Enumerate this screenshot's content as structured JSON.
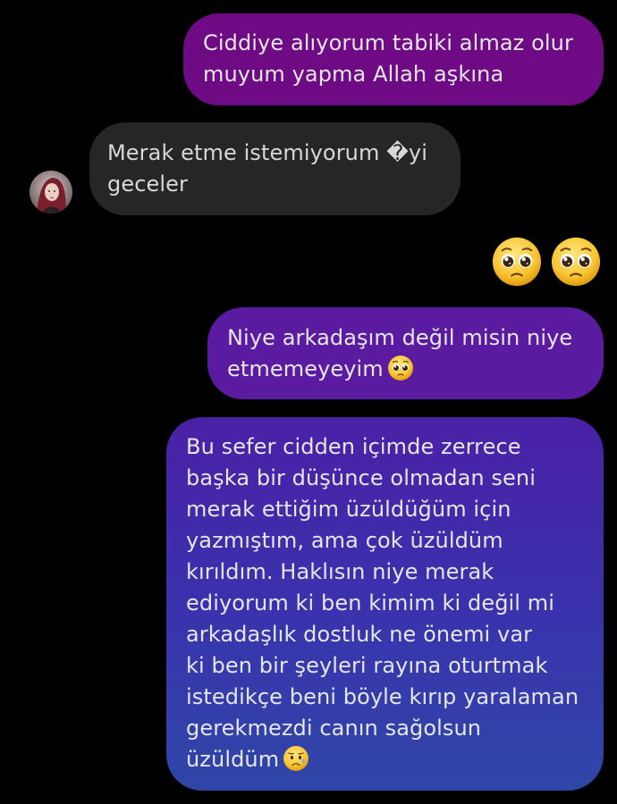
{
  "messages": [
    {
      "direction": "sent",
      "text": "Ciddiye alıyorum tabiki almaz olur\nmuyum yapma Allah aşkına"
    },
    {
      "direction": "received",
      "text": "Merak etme istemiyorum �yi\ngeceler"
    },
    {
      "direction": "sent",
      "emoji": [
        "pleading-face",
        "pleading-face"
      ]
    },
    {
      "direction": "sent",
      "text": "Niye arkadaşım değil misin niye\netmemeyeyim",
      "emoji": "pleading-face"
    },
    {
      "direction": "sent",
      "text": "Bu sefer cidden içimde zerrece\nbaşka bir düşünce olmadan seni\nmerak ettiğim üzüldüğüm için\nyazmıştım, ama çok üzüldüm\nkırıldım. Haklısın niye merak\nediyorum ki ben kimim ki değil mi\narkadaşlık dostluk ne önemi var\nki ben bir şeyleri rayına oturtmak\nistedikçe beni böyle kırıp yaralaman\ngerekmezdi canın sağolsun\nüzüldüm",
      "emoji": "sad-but-relieved-face"
    }
  ],
  "colors": {
    "background": "#000000",
    "sent_bubble_top": "#6f0a85",
    "sent_bubble_mid": "#5a1ba0",
    "sent_bubble_bottom": "#2f46a8",
    "received_bubble": "#262626",
    "text": "#e6e6e6"
  }
}
